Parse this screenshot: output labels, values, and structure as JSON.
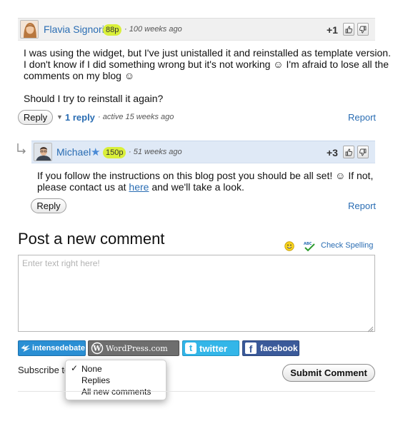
{
  "comment1": {
    "author": "Flavia Signori",
    "reputation": "88p",
    "time": "· 100 weeks ago",
    "score": "+1",
    "body_lines": [
      "I was using the widget, but I've just unistalled it and reinstalled as template version.",
      "I don't know if I did something wrong but it's not working ☺ I'm afraid to lose all the",
      "comments on my blog ☺",
      "",
      "Should I try to reinstall it again?"
    ],
    "reply_label": "Reply",
    "replies_label": "1 reply",
    "active_text": "· active 15 weeks ago",
    "report_label": "Report"
  },
  "comment2": {
    "author": "Michael",
    "reputation": "150p",
    "time": "· 51 weeks ago",
    "score": "+3",
    "body_line1": "If you follow the instructions on this blog post you should be all set! ☺ If not,",
    "body_line2_pre": "please contact us at ",
    "body_link": "here",
    "body_line2_post": " and we'll take a look.",
    "reply_label": "Reply",
    "report_label": "Report"
  },
  "post": {
    "heading": "Post a new comment",
    "check_spelling": "Check Spelling",
    "placeholder": "Enter text right here!"
  },
  "services": {
    "intensedebate": "intensedebate",
    "wordpress": "WordPress.com",
    "twitter": "twitter",
    "facebook": "facebook"
  },
  "subscribe": {
    "label": "Subscribe to",
    "options": [
      "None",
      "Replies",
      "All new comments"
    ],
    "selected": "None"
  },
  "submit_label": "Submit Comment",
  "colors": {
    "link": "#2a6db3",
    "reputation_badge": "#d9ef3a",
    "reply_bar": "#dfe9f6",
    "comment_bar": "#f0f0f0"
  }
}
